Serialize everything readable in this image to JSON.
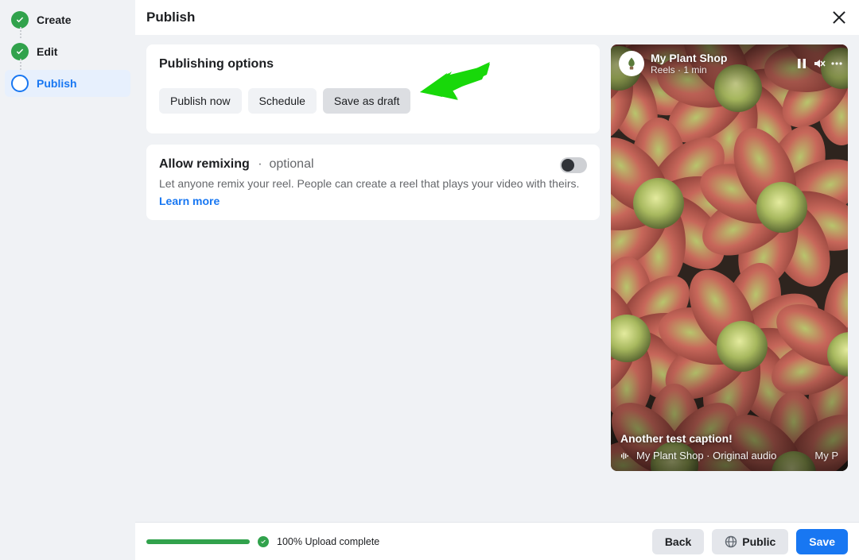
{
  "steps": {
    "create": "Create",
    "edit": "Edit",
    "publish": "Publish"
  },
  "header": {
    "title": "Publish"
  },
  "publishing": {
    "title": "Publishing options",
    "options": {
      "now": "Publish now",
      "schedule": "Schedule",
      "draft": "Save as draft"
    }
  },
  "remix": {
    "title": "Allow remixing",
    "optional": "optional",
    "description": "Let anyone remix your reel. People can create a reel that plays your video with theirs.",
    "learn_more": "Learn more"
  },
  "preview": {
    "profile_name": "My Plant Shop",
    "profile_sub": "Reels · 1 min",
    "caption": "Another test caption!",
    "audio": "My Plant Shop · Original audio",
    "audio_end": "My P"
  },
  "footer": {
    "upload_status": "100% Upload complete",
    "back": "Back",
    "audience": "Public",
    "save": "Save"
  }
}
